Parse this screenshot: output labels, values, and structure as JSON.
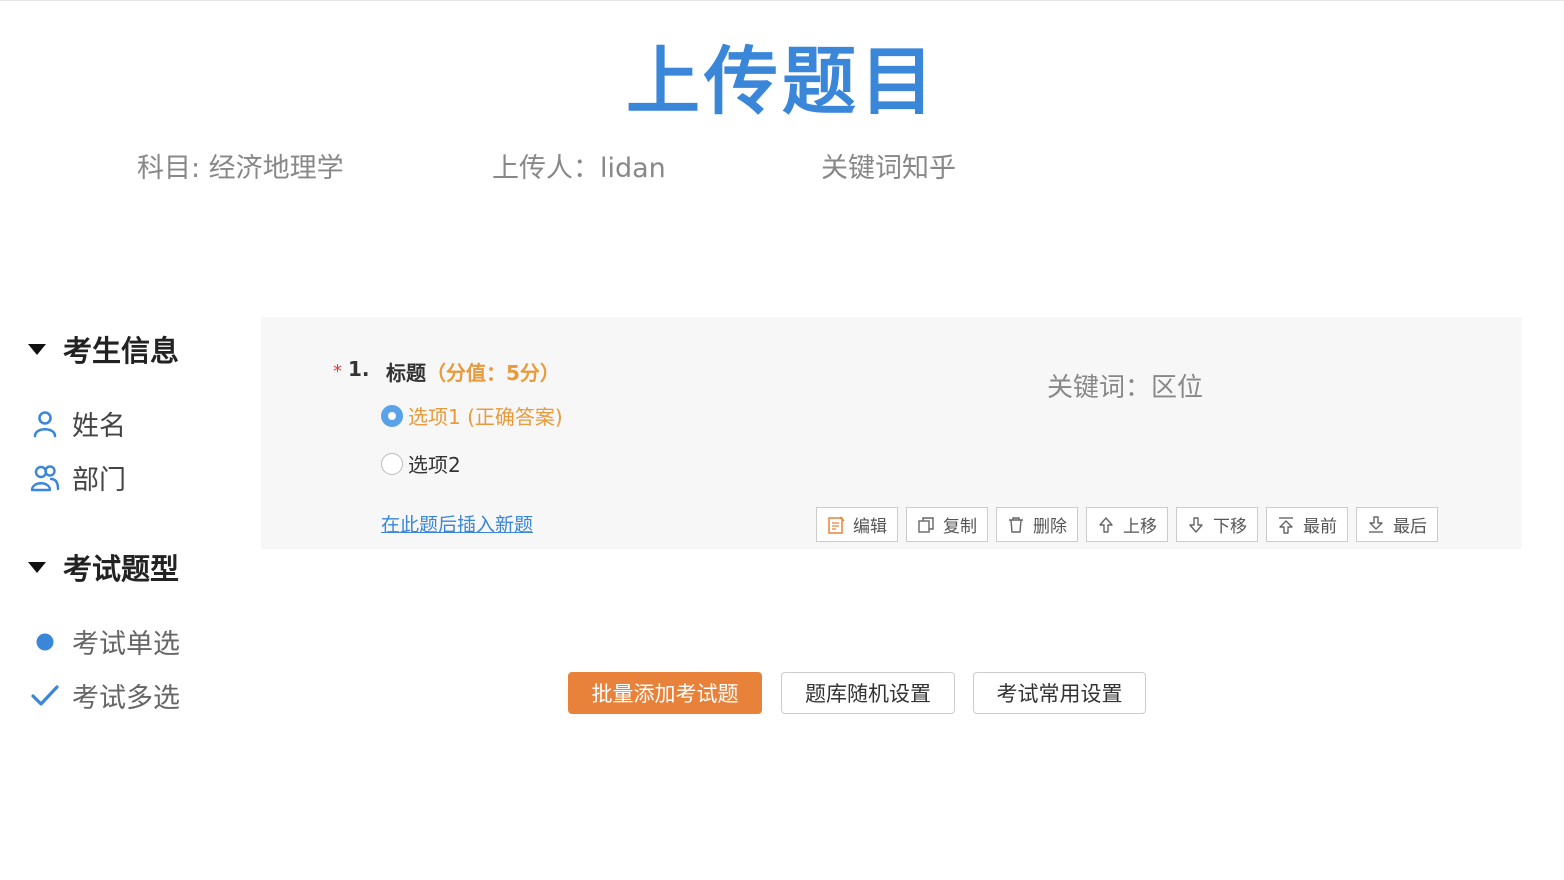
{
  "header": {
    "title": "上传题目",
    "subject": "科目: 经济地理学",
    "uploader": "上传人：lidan",
    "keywords": "关键词知乎"
  },
  "sidebar": {
    "sections": [
      {
        "heading": "考生信息",
        "items": [
          {
            "label": "姓名",
            "icon": "person-icon"
          },
          {
            "label": "部门",
            "icon": "group-icon"
          }
        ]
      },
      {
        "heading": "考试题型",
        "items": [
          {
            "label": "考试单选",
            "icon": "dot-icon"
          },
          {
            "label": "考试多选",
            "icon": "check-icon"
          }
        ]
      }
    ]
  },
  "question": {
    "required_mark": "*",
    "number": "1.",
    "title": "标题",
    "score": "（分值：5分）",
    "keywords": "关键词：区位",
    "options": [
      {
        "label": "选项1 (正确答案)",
        "selected": true
      },
      {
        "label": "选项2",
        "selected": false
      }
    ],
    "insert_link": "在此题后插入新题",
    "toolbar": [
      {
        "label": "编辑",
        "icon": "edit-icon"
      },
      {
        "label": "复制",
        "icon": "copy-icon"
      },
      {
        "label": "删除",
        "icon": "delete-icon"
      },
      {
        "label": "上移",
        "icon": "arrow-up-icon"
      },
      {
        "label": "下移",
        "icon": "arrow-down-icon"
      },
      {
        "label": "最前",
        "icon": "move-top-icon"
      },
      {
        "label": "最后",
        "icon": "move-bottom-icon"
      }
    ]
  },
  "actions": {
    "batch_add": "批量添加考试题",
    "random_settings": "题库随机设置",
    "common_settings": "考试常用设置"
  },
  "colors": {
    "accent_blue": "#3a86d8",
    "accent_orange": "#e8823a",
    "score_orange": "#e89a3c",
    "required_red": "#e23b3b"
  }
}
